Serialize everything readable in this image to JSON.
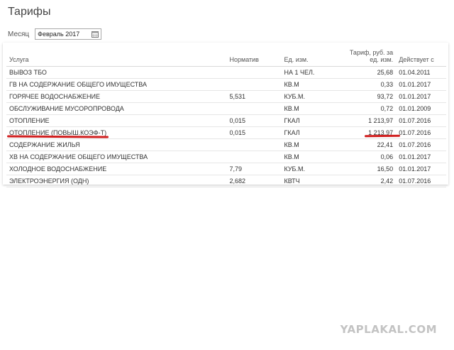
{
  "page": {
    "title": "Тарифы"
  },
  "filter": {
    "month_label": "Месяц",
    "month_value": "Февраль 2017",
    "calendar_icon": "calendar-icon"
  },
  "table": {
    "headers": {
      "service": "Услуга",
      "norm": "Норматив",
      "unit": "Ед. изм.",
      "tariff_line1": "Тариф, руб. за",
      "tariff_line2": "ед. изм.",
      "date": "Действует с"
    },
    "rows": [
      {
        "service": "ВЫВОЗ ТБО",
        "norm": "",
        "unit": "НА 1 ЧЕЛ.",
        "tariff": "25,68",
        "date": "01.04.2011"
      },
      {
        "service": "ГВ НА СОДЕРЖАНИЕ ОБЩЕГО ИМУЩЕСТВА",
        "norm": "",
        "unit": "КВ.М",
        "tariff": "0,33",
        "date": "01.01.2017"
      },
      {
        "service": "ГОРЯЧЕЕ ВОДОСНАБЖЕНИЕ",
        "norm": "5,531",
        "unit": "КУБ.М.",
        "tariff": "93,72",
        "date": "01.01.2017"
      },
      {
        "service": "ОБСЛУЖИВАНИЕ МУСОРОПРОВОДА",
        "norm": "",
        "unit": "КВ.М",
        "tariff": "0,72",
        "date": "01.01.2009"
      },
      {
        "service": "ОТОПЛЕНИЕ",
        "norm": "0,015",
        "unit": "ГКАЛ",
        "tariff": "1 213,97",
        "date": "01.07.2016"
      },
      {
        "service": "ОТОПЛЕНИЕ (ПОВЫШ.КОЭФ-Т)",
        "norm": "0,015",
        "unit": "ГКАЛ",
        "tariff": "1 213,97",
        "date": "01.07.2016"
      },
      {
        "service": "СОДЕРЖАНИЕ ЖИЛЬЯ",
        "norm": "",
        "unit": "КВ.М",
        "tariff": "22,41",
        "date": "01.07.2016"
      },
      {
        "service": "ХВ НА СОДЕРЖАНИЕ ОБЩЕГО ИМУЩЕСТВА",
        "norm": "",
        "unit": "КВ.М",
        "tariff": "0,06",
        "date": "01.01.2017"
      },
      {
        "service": "ХОЛОДНОЕ ВОДОСНАБЖЕНИЕ",
        "norm": "7,79",
        "unit": "КУБ.М.",
        "tariff": "16,50",
        "date": "01.01.2017"
      },
      {
        "service": "ЭЛЕКТРОЭНЕРГИЯ (ОДН)",
        "norm": "2,682",
        "unit": "КВТЧ",
        "tariff": "2,42",
        "date": "01.07.2016"
      }
    ]
  },
  "annotation": {
    "color": "#d11f1f"
  },
  "watermark": {
    "text": "YAPLAKAL.COM"
  }
}
